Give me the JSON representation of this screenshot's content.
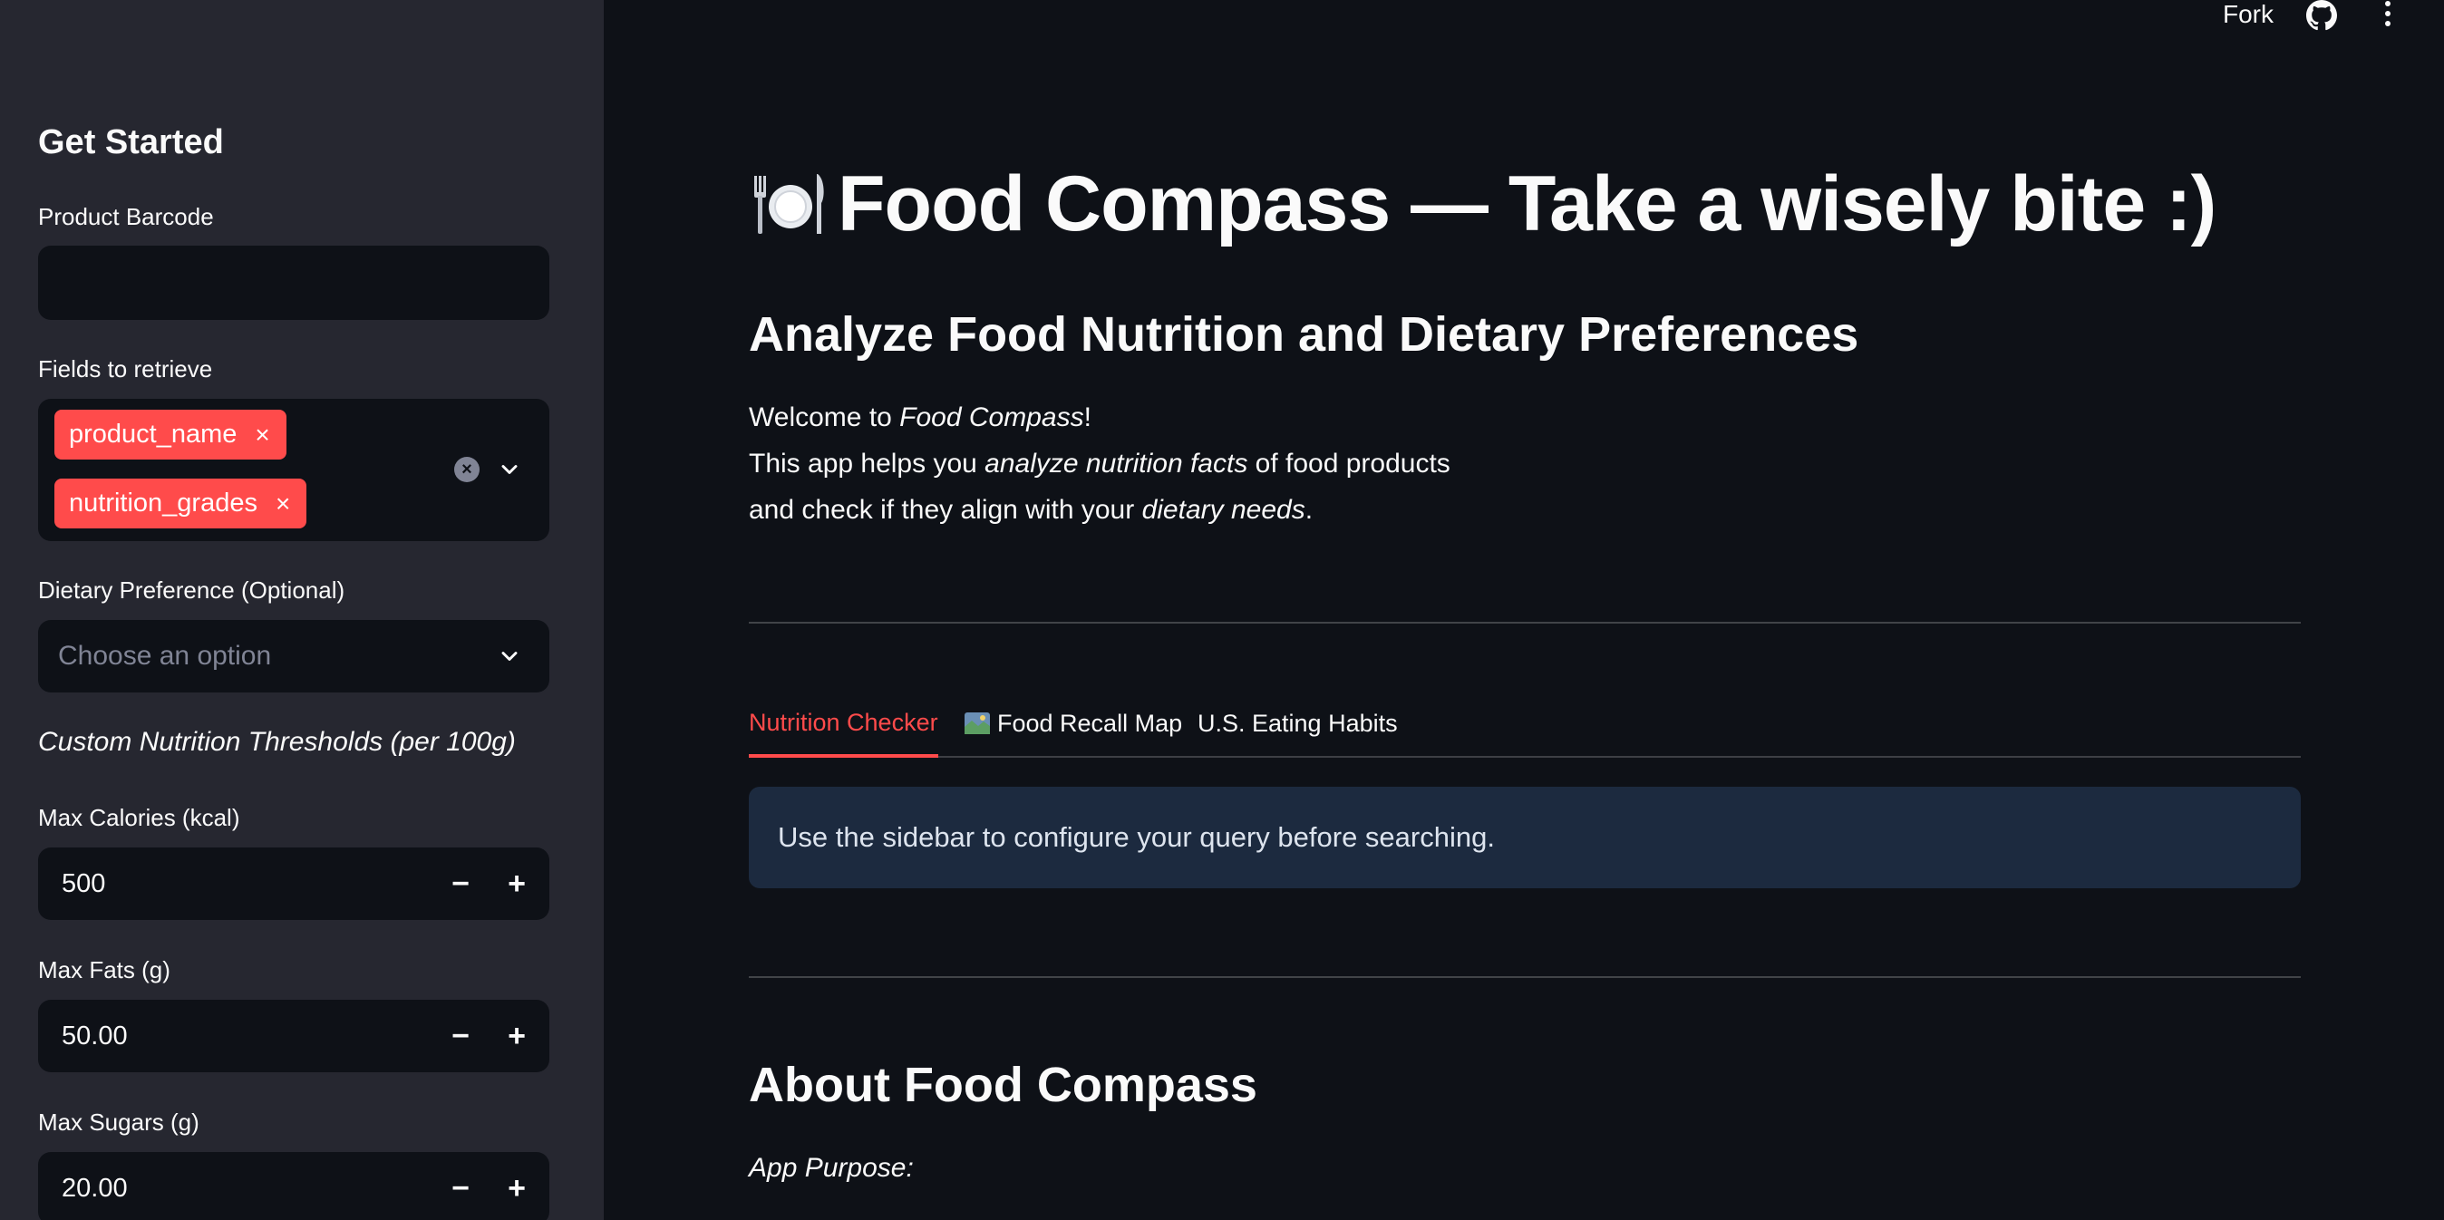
{
  "toolbar": {
    "fork_label": "Fork",
    "github_icon": "github-icon",
    "menu_icon": "kebab-menu-icon"
  },
  "sidebar": {
    "heading": "Get Started",
    "barcode": {
      "label": "Product Barcode",
      "value": ""
    },
    "fields": {
      "label": "Fields to retrieve",
      "selected": [
        "product_name",
        "nutrition_grades"
      ],
      "remove_glyph": "×",
      "clear_glyph": "×"
    },
    "dietary": {
      "label": "Dietary Preference (Optional)",
      "placeholder": "Choose an option"
    },
    "thresholds_heading": "Custom Nutrition Thresholds (per 100g)",
    "max_calories": {
      "label": "Max Calories (kcal)",
      "value": "500"
    },
    "max_fats": {
      "label": "Max Fats (g)",
      "value": "50.00"
    },
    "max_sugars": {
      "label": "Max Sugars (g)",
      "value": "20.00"
    },
    "stepper": {
      "minus": "−",
      "plus": "+"
    }
  },
  "main": {
    "title": "Food Compass — Take a wisely bite :)",
    "title_icon": "plate-with-cutlery-icon",
    "subtitle": "Analyze Food Nutrition and Dietary Preferences",
    "intro": {
      "line1_a": "Welcome to ",
      "line1_em": "Food Compass",
      "line1_b": "!",
      "line2_a": "This app helps you ",
      "line2_em": "analyze nutrition facts",
      "line2_b": " of food products",
      "line3_a": "and check if they align with your ",
      "line3_em": "dietary needs",
      "line3_b": "."
    },
    "tabs": [
      {
        "label": "Nutrition Checker",
        "active": true
      },
      {
        "label": "Food Recall Map",
        "icon": "map-icon",
        "active": false
      },
      {
        "label": "U.S. Eating Habits",
        "active": false
      }
    ],
    "info_message": "Use the sidebar to configure your query before searching.",
    "about_heading": "About Food Compass",
    "app_purpose_label": "App Purpose:"
  },
  "colors": {
    "accent": "#ff4b4b",
    "background": "#0e1117",
    "sidebar_bg": "#262730",
    "info_bg": "#1c2a3f"
  }
}
